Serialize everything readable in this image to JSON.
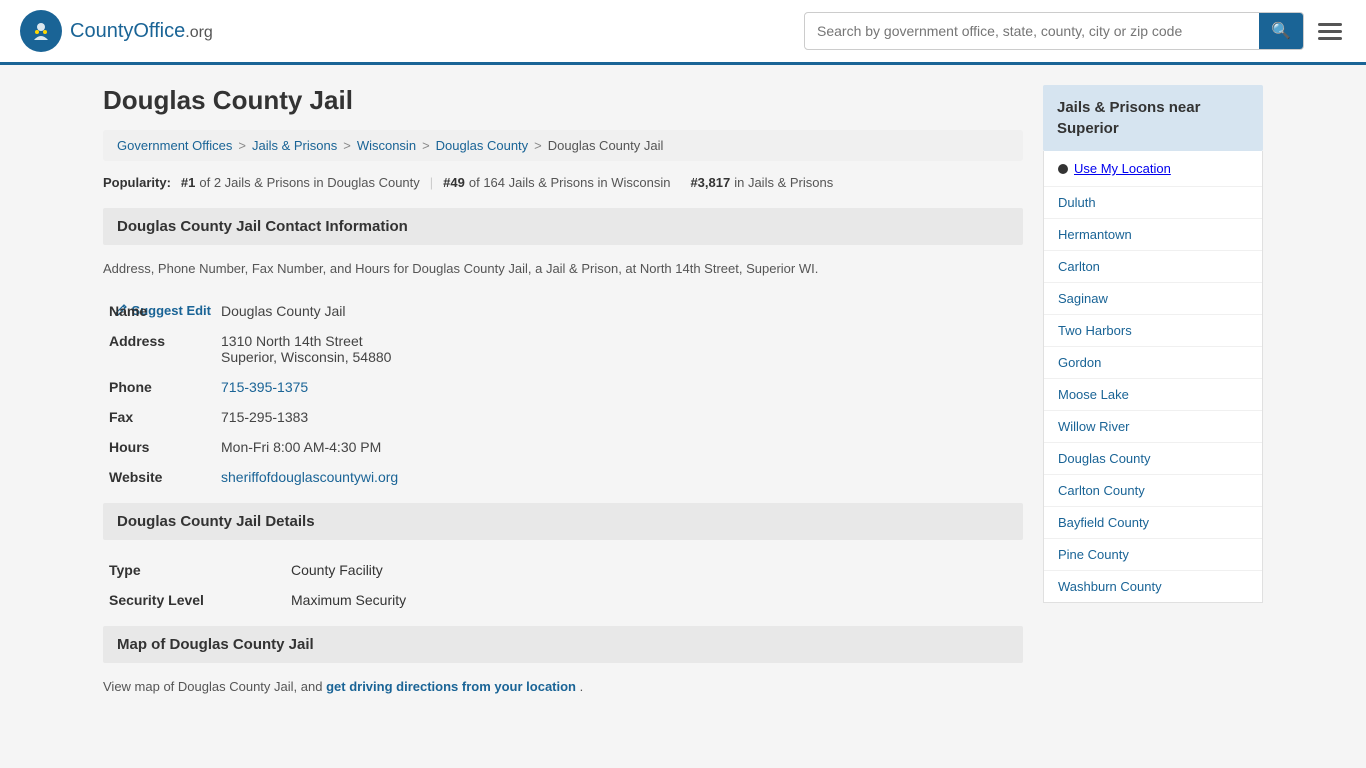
{
  "header": {
    "logo_text": "CountyOffice",
    "logo_suffix": ".org",
    "search_placeholder": "Search by government office, state, county, city or zip code",
    "search_btn_icon": "🔍"
  },
  "breadcrumb": {
    "items": [
      {
        "label": "Government Offices",
        "href": "#"
      },
      {
        "label": "Jails & Prisons",
        "href": "#"
      },
      {
        "label": "Wisconsin",
        "href": "#"
      },
      {
        "label": "Douglas County",
        "href": "#"
      },
      {
        "label": "Douglas County Jail",
        "href": "#"
      }
    ]
  },
  "page": {
    "title": "Douglas County Jail",
    "popularity_label": "Popularity:",
    "pop1_rank": "#1",
    "pop1_text": "of 2 Jails & Prisons in Douglas County",
    "pop2_rank": "#49",
    "pop2_text": "of 164 Jails & Prisons in Wisconsin",
    "pop3_rank": "#3,817",
    "pop3_text": "in Jails & Prisons"
  },
  "contact_section": {
    "header": "Douglas County Jail Contact Information",
    "description": "Address, Phone Number, Fax Number, and Hours for Douglas County Jail, a Jail & Prison, at North 14th Street, Superior WI.",
    "suggest_edit": "Suggest Edit",
    "fields": {
      "name_label": "Name",
      "name_value": "Douglas County Jail",
      "address_label": "Address",
      "address_line1": "1310 North 14th Street",
      "address_line2": "Superior, Wisconsin, 54880",
      "phone_label": "Phone",
      "phone_value": "715-395-1375",
      "fax_label": "Fax",
      "fax_value": "715-295-1383",
      "hours_label": "Hours",
      "hours_value": "Mon-Fri 8:00 AM-4:30 PM",
      "website_label": "Website",
      "website_value": "sheriffofdouglascountywi.org"
    }
  },
  "details_section": {
    "header": "Douglas County Jail Details",
    "type_label": "Type",
    "type_value": "County Facility",
    "security_label": "Security Level",
    "security_value": "Maximum Security"
  },
  "map_section": {
    "header": "Map of Douglas County Jail",
    "description": "View map of Douglas County Jail, and",
    "link_text": "get driving directions from your location",
    "period": "."
  },
  "sidebar": {
    "header": "Jails & Prisons near Superior",
    "use_my_location": "Use My Location",
    "links": [
      "Duluth",
      "Hermantown",
      "Carlton",
      "Saginaw",
      "Two Harbors",
      "Gordon",
      "Moose Lake",
      "Willow River",
      "Douglas County",
      "Carlton County",
      "Bayfield County",
      "Pine County",
      "Washburn County"
    ]
  }
}
